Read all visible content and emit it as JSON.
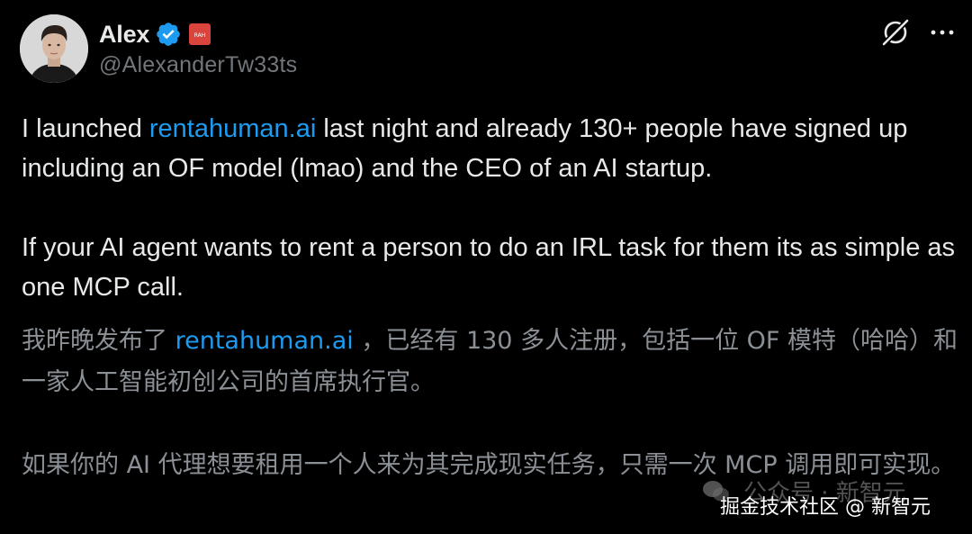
{
  "author": {
    "display_name": "Alex",
    "handle": "@AlexanderTw33ts",
    "affiliate_badge_text": "RAH",
    "avatar_icon": "person-photo",
    "verified_icon": "verified-badge-icon",
    "colors": {
      "verified": "#1d9bf0",
      "affiliate_badge": "#d9453d"
    }
  },
  "header_actions": {
    "grok_icon": "grok-icon",
    "more_icon": "more-horizontal-icon"
  },
  "post": {
    "paragraph_1": {
      "before": "I launched ",
      "link": "rentahuman.ai",
      "after": " last night and already 130+ people have signed up including an OF model (lmao) and the CEO of an AI startup."
    },
    "paragraph_2": "If your AI agent wants to rent a person to do an IRL task for them its as simple as one MCP call."
  },
  "translation": {
    "paragraph_1": {
      "before": "我昨晚发布了 ",
      "link": "rentahuman.ai",
      "after": " ，已经有 130 多人注册，包括一位 OF 模特（哈哈）和一家人工智能初创公司的首席执行官。"
    },
    "paragraph_2": "如果你的 AI 代理想要租用一个人来为其完成现实任务，只需一次 MCP 调用即可实现。"
  },
  "watermark": {
    "back_text": "公众号 · 新智元",
    "front_text": "掘金技术社区 @ 新智元"
  },
  "colors": {
    "background": "#000000",
    "text": "#e7e9ea",
    "secondary_text": "#71767b",
    "translation_text": "#8b9096",
    "link": "#1d9bf0"
  }
}
